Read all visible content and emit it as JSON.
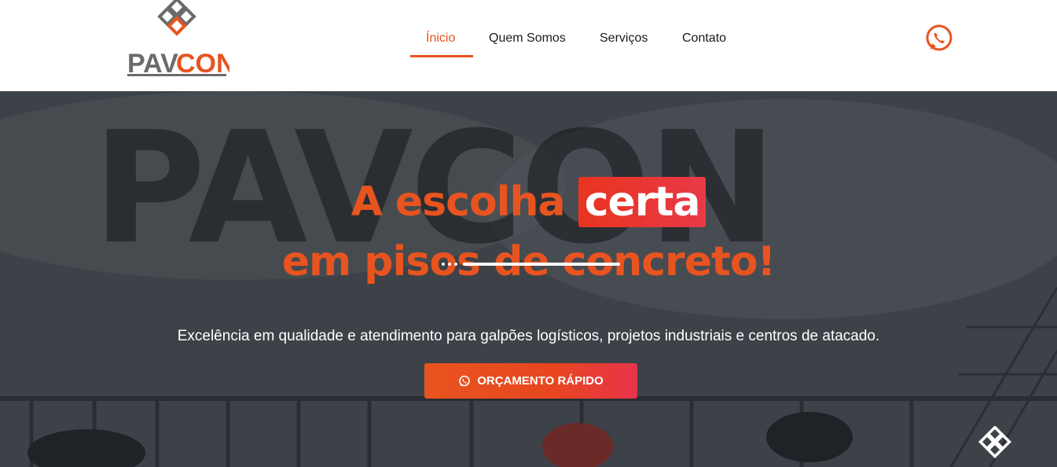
{
  "brand": {
    "name_part1": "PAV",
    "name_part2": "CON",
    "accent_color": "#e8541f",
    "gray_color": "#6b6b6b"
  },
  "nav": {
    "items": [
      {
        "label": "Ínicio",
        "active": true
      },
      {
        "label": "Quem Somos",
        "active": false
      },
      {
        "label": "Serviços",
        "active": false
      },
      {
        "label": "Contato",
        "active": false
      }
    ],
    "whatsapp_icon": "whatsapp-icon"
  },
  "hero": {
    "background_word": "PAVCON",
    "headline_line1_prefix": "A escolha",
    "headline_highlight": "certa",
    "headline_line2": "em pisos de concreto!",
    "subtitle": "Excelência em qualidade e atendimento para galpões logísticos, projetos industriais e centros de atacado.",
    "cta_label": "ORÇAMENTO RÁPIDO",
    "cta_icon": "whatsapp-icon",
    "corner_icon": "pavcon-knot-icon"
  }
}
